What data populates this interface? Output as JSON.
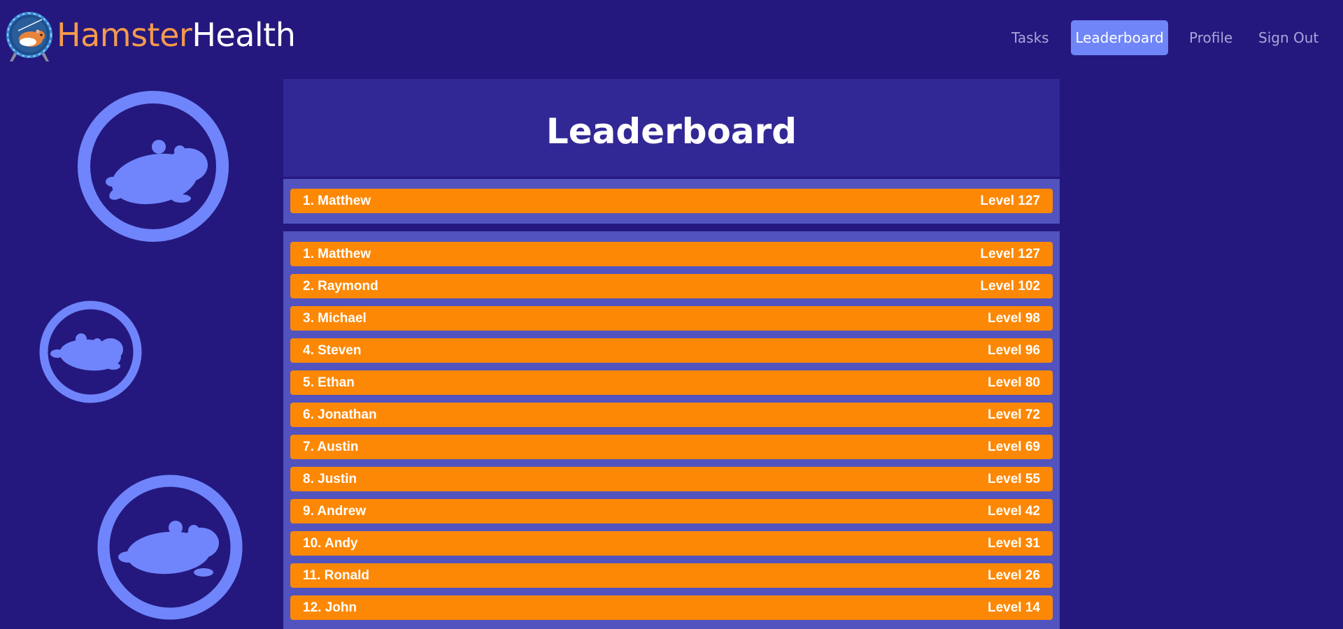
{
  "header": {
    "brand_part1": "Hamster",
    "brand_part2": "Health",
    "nav": [
      {
        "label": "Tasks",
        "active": false
      },
      {
        "label": "Leaderboard",
        "active": true
      },
      {
        "label": "Profile",
        "active": false
      },
      {
        "label": "Sign Out",
        "active": false
      }
    ]
  },
  "leaderboard": {
    "title": "Leaderboard",
    "current_user": {
      "name": "1. Matthew",
      "level": "Level 127"
    },
    "entries": [
      {
        "name": "1. Matthew",
        "level": "Level 127"
      },
      {
        "name": "2. Raymond",
        "level": "Level 102"
      },
      {
        "name": "3. Michael",
        "level": "Level 98"
      },
      {
        "name": "4. Steven",
        "level": "Level 96"
      },
      {
        "name": "5. Ethan",
        "level": "Level 80"
      },
      {
        "name": "6. Jonathan",
        "level": "Level 72"
      },
      {
        "name": "7. Austin",
        "level": "Level 69"
      },
      {
        "name": "8. Justin",
        "level": "Level 55"
      },
      {
        "name": "9. Andrew",
        "level": "Level 42"
      },
      {
        "name": "10. Andy",
        "level": "Level 31"
      },
      {
        "name": "11. Ronald",
        "level": "Level 26"
      },
      {
        "name": "12. John",
        "level": "Level 14"
      }
    ]
  },
  "colors": {
    "background": "#24187e",
    "panel_header": "#322895",
    "panel_band": "#5353bf",
    "row": "#fd8805",
    "accent": "#6f85f8",
    "brand_orange": "#f59a4c"
  }
}
